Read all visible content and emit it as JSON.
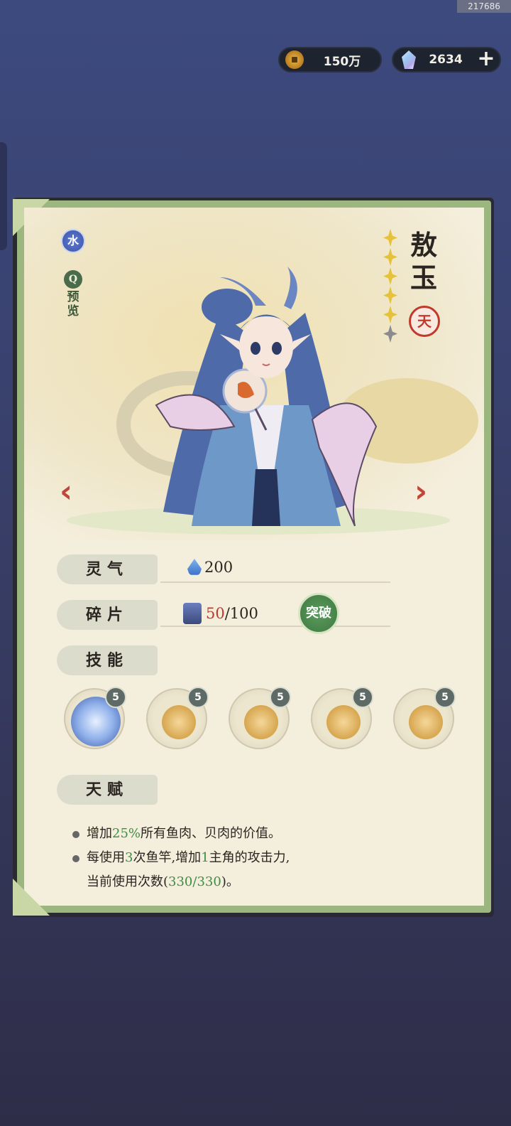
{
  "build_id": "217686",
  "currency": {
    "coins": {
      "icon": "coin-icon",
      "value": "150万"
    },
    "gems": {
      "icon": "gem-icon",
      "value": "2634",
      "add_label": "+"
    }
  },
  "hero": {
    "element": "水",
    "preview_label": "预览",
    "name": "敖玉",
    "rank_seal": "天",
    "stars": {
      "filled": 5,
      "total": 6
    },
    "prev_arrow": "‹",
    "next_arrow": "›"
  },
  "stats": {
    "spirit": {
      "label": "灵气",
      "value": "200"
    },
    "shards": {
      "label": "碎片",
      "current": "50",
      "max": "/100",
      "action": "突破"
    },
    "skills_label": "技能",
    "talent_label": "天赋"
  },
  "skills": [
    {
      "name": "skill-hero-portrait",
      "level": "5",
      "active": true
    },
    {
      "name": "skill-fish",
      "level": "5",
      "active": false
    },
    {
      "name": "skill-basket",
      "level": "5",
      "active": false
    },
    {
      "name": "skill-rice",
      "level": "5",
      "active": false
    },
    {
      "name": "skill-cat",
      "level": "5",
      "active": false
    }
  ],
  "talents": [
    {
      "pre": "增加",
      "hl": "25%",
      "post": "所有鱼肉、贝肉的价值。"
    },
    {
      "pre": "每使用",
      "hl": "3",
      "mid": "次鱼竿,增加",
      "hl2": "1",
      "post": "主角的攻击力,",
      "line2_pre": "当前使用次数(",
      "line2_hl": "330/330",
      "line2_post": ")。"
    }
  ],
  "colors": {
    "accent_green": "#3f8d45",
    "shard_red": "#c0392b",
    "panel_border": "#9cb67f"
  }
}
